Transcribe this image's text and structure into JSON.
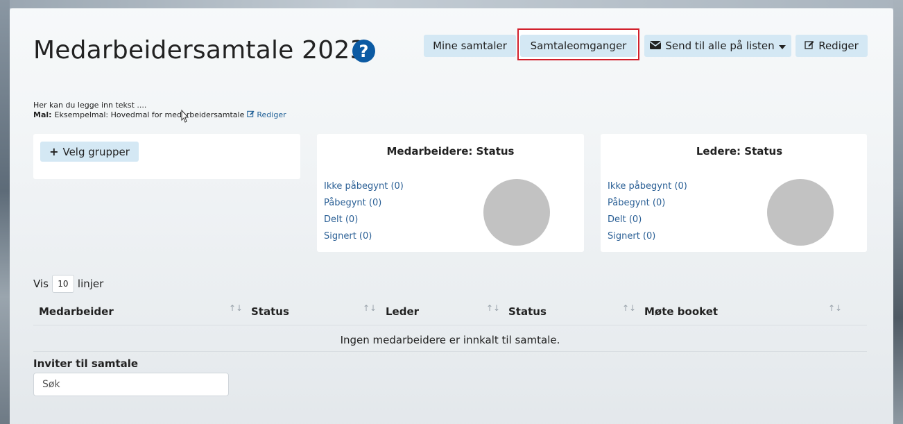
{
  "header": {
    "title": "Medarbeidersamtale 2023",
    "help_icon": "question-circle-icon"
  },
  "toolbar": {
    "mine_samtaler": "Mine samtaler",
    "samtaleomganger": "Samtaleomganger",
    "send_til_alle": "Send til alle på listen",
    "send_icon": "envelope-icon",
    "caret_icon": "caret-down-icon",
    "rediger": "Rediger",
    "rediger_icon": "edit-icon",
    "highlight_color": "#d21f2b"
  },
  "intro": {
    "text": "Her kan du legge inn tekst ....",
    "mal_label": "Mal:",
    "mal_value": "Eksempelmal: Hovedmal for medarbeidersamtale",
    "rediger_link": "Rediger"
  },
  "groups": {
    "button_label": "Velg grupper",
    "icon": "plus-icon"
  },
  "medarbeidere_status": {
    "title": "Medarbeidere: Status",
    "items": [
      "Ikke påbegynt (0)",
      "Påbegynt (0)",
      "Delt (0)",
      "Signert (0)"
    ]
  },
  "ledere_status": {
    "title": "Ledere: Status",
    "items": [
      "Ikke påbegynt (0)",
      "Påbegynt (0)",
      "Delt (0)",
      "Signert (0)"
    ]
  },
  "table_controls": {
    "vis": "Vis",
    "rows_value": "10",
    "linjer": "linjer"
  },
  "table": {
    "columns": [
      "Medarbeider",
      "Status",
      "Leder",
      "Status",
      "Møte booket"
    ],
    "empty_message": "Ingen medarbeidere er innkalt til samtale."
  },
  "invite": {
    "label": "Inviter til samtale",
    "placeholder": "Søk"
  },
  "colors": {
    "accent_button": "#d4e8f4",
    "link": "#1f5f96",
    "help_icon_bg": "#0b5aa3",
    "pie_empty": "#c2c2c2"
  }
}
